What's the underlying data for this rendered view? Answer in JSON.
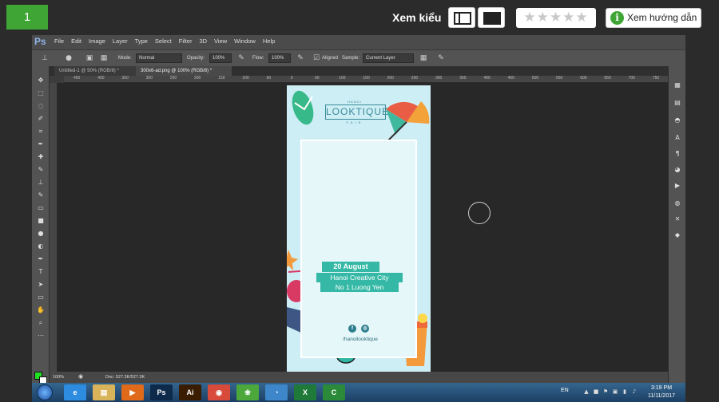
{
  "viewer": {
    "slide_number": "1",
    "view_label": "Xem kiểu",
    "rating_stars": "★★★★★",
    "guide_label": "Xem hướng dẫn",
    "info_glyph": "i"
  },
  "photoshop": {
    "logo": "Ps",
    "menus": [
      "File",
      "Edit",
      "Image",
      "Layer",
      "Type",
      "Select",
      "Filter",
      "3D",
      "View",
      "Window",
      "Help"
    ],
    "options": {
      "mode_label": "Mode:",
      "mode_value": "Normal",
      "opacity_label": "Opacity:",
      "opacity_value": "100%",
      "flow_label": "Flow:",
      "flow_value": "100%",
      "aligned_label": "Aligned",
      "sample_label": "Sample:",
      "sample_value": "Current Layer"
    },
    "tabs": [
      {
        "label": "Untitled-1 @ 50% (RGB/8) *",
        "active": false
      },
      {
        "label": "300x6-ad.png @ 100% (RGB/8) *",
        "active": true
      }
    ],
    "ruler_ticks": [
      "450",
      "400",
      "350",
      "300",
      "250",
      "200",
      "150",
      "100",
      "50",
      "0",
      "50",
      "100",
      "150",
      "200",
      "250",
      "300",
      "350",
      "400",
      "450",
      "500",
      "550",
      "600",
      "650",
      "700",
      "750"
    ],
    "status": {
      "zoom": "100%",
      "doc": "Doc: 527.3K/527.3K"
    },
    "foreground_color": "#22e022",
    "background_color": "#ffffff"
  },
  "banner": {
    "brand_sub": "HANOI",
    "brand_name": "LOOKTIQUE",
    "brand_fair": "FAIR",
    "date": "20 August",
    "place": "Hanoi Creative City",
    "address": "No 1 Luong Yen",
    "facebook_glyph": "f",
    "instagram_glyph": "◎",
    "handle": "/hanoilooktique",
    "colors": {
      "bg": "#cdeef5",
      "accent": "#35b9a6",
      "text": "#3a8a98"
    }
  },
  "taskbar": {
    "items": [
      {
        "name": "ie-icon",
        "glyph": "e",
        "color": "#2d8ce0"
      },
      {
        "name": "folder-icon",
        "glyph": "▤",
        "color": "#d9b35a"
      },
      {
        "name": "media-player-icon",
        "glyph": "▶",
        "color": "#e06a1a"
      },
      {
        "name": "photoshop-icon",
        "glyph": "Ps",
        "color": "#0e2a4a"
      },
      {
        "name": "illustrator-icon",
        "glyph": "Ai",
        "color": "#3a1c00"
      },
      {
        "name": "chrome-icon",
        "glyph": "◉",
        "color": "#d84a3a"
      },
      {
        "name": "coccoc-icon",
        "glyph": "❀",
        "color": "#4ca83b"
      },
      {
        "name": "chat-icon",
        "glyph": "◔",
        "color": "#3d86c9"
      },
      {
        "name": "excel-icon",
        "glyph": "X",
        "color": "#1f7a3a"
      },
      {
        "name": "camtasia-icon",
        "glyph": "C",
        "color": "#2a8a3a"
      }
    ],
    "lang": "EN",
    "time": "3:19 PM",
    "date": "11/11/2017"
  }
}
